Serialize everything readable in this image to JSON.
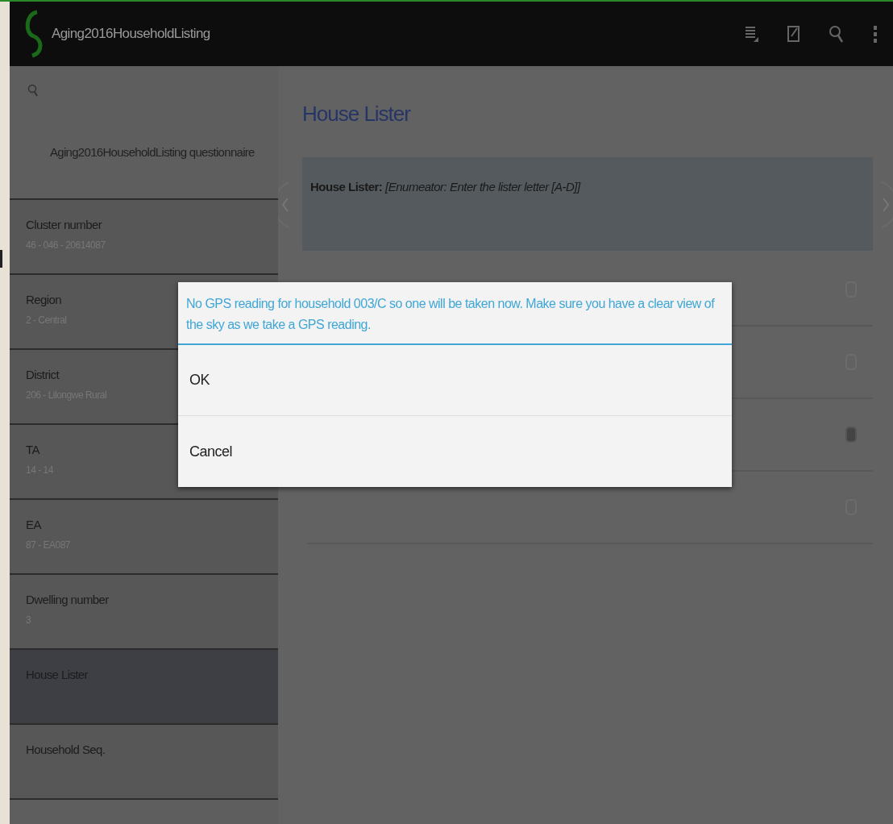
{
  "app_bar": {
    "title": "Aging2016HouseholdListing"
  },
  "sidebar": {
    "heading": "Aging2016HouseholdListing questionnaire",
    "items": [
      {
        "label": "Cluster number",
        "value": "46 - 046 - 20614087",
        "selected": false
      },
      {
        "label": "Region",
        "value": "2 - Central",
        "selected": false
      },
      {
        "label": "District",
        "value": "206 - Lilongwe Rural",
        "selected": false
      },
      {
        "label": "TA",
        "value": "14 - 14",
        "selected": false
      },
      {
        "label": "EA",
        "value": "87 - EA087",
        "selected": false
      },
      {
        "label": "Dwelling number",
        "value": "3",
        "selected": false
      },
      {
        "label": "House Lister",
        "selected": true
      },
      {
        "label": "Household Seq.",
        "selected": false
      }
    ]
  },
  "main": {
    "title": "House Lister",
    "question": "**House Lister:** *[Enumeator: Enter the lister letter [A-D]]*",
    "options": [
      {
        "selected": false
      },
      {
        "selected": false
      },
      {
        "selected": true
      },
      {
        "selected": false
      }
    ]
  },
  "dialog": {
    "message": "No GPS reading for household 003/C so one will be taken now. Make sure you have a clear view of the sky as we take a GPS reading.",
    "buttons": [
      "OK",
      "Cancel"
    ]
  }
}
